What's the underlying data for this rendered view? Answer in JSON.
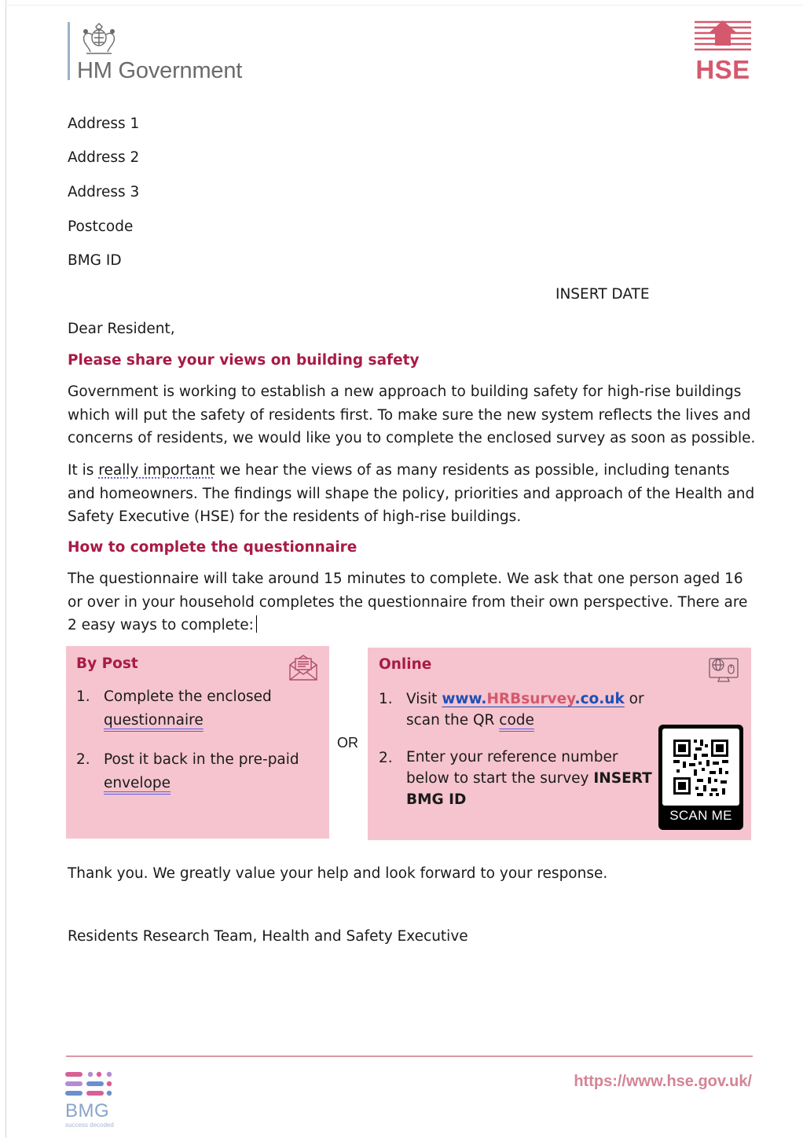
{
  "header": {
    "government_name": "HM Government",
    "hse_logo_text": "HSE"
  },
  "address": [
    "Address 1",
    "Address 2",
    "Address 3",
    "Postcode",
    "BMG ID"
  ],
  "date": "INSERT DATE",
  "salutation": "Dear Resident,",
  "section1": {
    "heading": "Please share your views on building safety",
    "para1": "Government is working to establish a new approach to building safety for high-rise buildings which will put the safety of residents first. To make sure the new system reflects the lives and concerns of residents, we would like you to complete the enclosed survey as soon as possible.",
    "para2_before": "It is ",
    "para2_emph": "really important",
    "para2_after": " we hear the views of as many residents as possible, including tenants and homeowners. The findings will shape the policy, priorities and approach of the Health and Safety Executive (HSE) for the residents of high-rise buildings."
  },
  "section2": {
    "heading": "How to complete the questionnaire",
    "para": "The questionnaire will take around 15 minutes to complete. We ask that one person aged 16 or over in your household completes the questionnaire from their own perspective. There are 2 easy ways to complete:"
  },
  "by_post": {
    "title": "By Post",
    "icon": "envelope-letter-icon",
    "item1_num": "1.",
    "item1_line1": "Complete the enclosed",
    "item1_line2": "questionnaire",
    "item2_num": "2.",
    "item2_line1": "Post it back in the pre-paid",
    "item2_line2": "envelope"
  },
  "or_label": "OR",
  "online": {
    "title": "Online",
    "icon": "computer-globe-icon",
    "item1_num": "1.",
    "item1_visit": "Visit ",
    "url_part1": "www.",
    "url_part2": "HRBsurvey",
    "url_part3": ".co.uk",
    "item1_or": " or",
    "item1_line2_prefix": "scan the QR ",
    "item1_line2_code": "code",
    "item2_num": "2.",
    "item2_line1": "Enter your reference number",
    "item2_line2_prefix": "below to start the survey ",
    "item2_line2_bold": "INSERT",
    "item2_line3_bold": "BMG ID",
    "qr_label": "SCAN ME"
  },
  "closing": {
    "thanks": "Thank you. We greatly value your help and look forward to your response.",
    "signoff": "Residents Research Team, Health and Safety Executive"
  },
  "footer": {
    "bmg_word": "BMG",
    "bmg_tagline": "success decoded",
    "url": "https://www.hse.gov.uk/"
  },
  "colors": {
    "heading": "#a81b46",
    "box_background": "#f5c4cf",
    "hse_logo": "#d4596d",
    "link": "#1f4fb5"
  }
}
